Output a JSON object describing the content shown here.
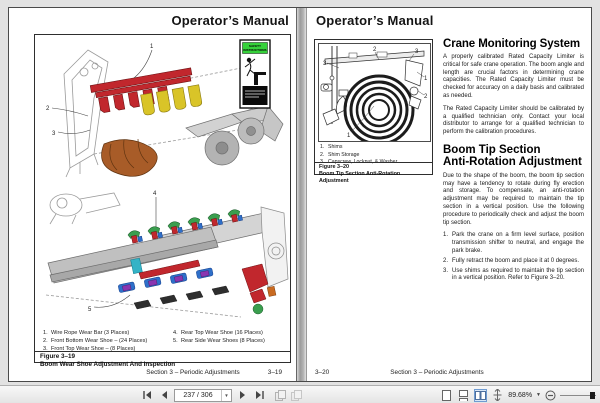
{
  "colors": {
    "safety_green": "#35d13a",
    "diagram_red": "#c1272d",
    "diagram_yellow": "#d9c428",
    "diagram_orange": "#a85c28",
    "diagram_green": "#3a9e4e",
    "diagram_blue": "#2e6fc9",
    "diagram_cyan": "#35b3c6",
    "diagram_purple": "#8a35b0",
    "active_view_blue": "#6f9bd1"
  },
  "left_page": {
    "header": "Operator’s Manual",
    "figure": {
      "callouts": [
        "1",
        "2",
        "3",
        "4",
        "5"
      ],
      "safety_label": {
        "line1": "SAFETY",
        "line2": "INSTRUCTIONS"
      },
      "legend_col1": [
        {
          "num": "1.",
          "text": "Wire Rope Wear Bar (3 Places)"
        },
        {
          "num": "2.",
          "text": "Front Bottom Wear Shoe – (24 Places)"
        },
        {
          "num": "3.",
          "text": "Front Top Wear Shoe – (8 Places)"
        }
      ],
      "legend_col2": [
        {
          "num": "4.",
          "text": "Rear Top Wear Shoe (16 Places)"
        },
        {
          "num": "5.",
          "text": "Rear Side Wear Shoes (8 Places)"
        }
      ],
      "caption_number": "Figure 3–19",
      "caption_title": "Boom Wear Shoe Adjustment And Inspection"
    },
    "footer_section": "Section 3 – Periodic Adjustments",
    "footer_page": "3–19"
  },
  "right_page": {
    "header": "Operator’s Manual",
    "figure": {
      "callouts": [
        "3",
        "2",
        "3",
        "1",
        "2",
        "1"
      ],
      "legend": [
        {
          "num": "1.",
          "text": "Shims"
        },
        {
          "num": "2.",
          "text": "Shim Storage"
        },
        {
          "num": "3.",
          "text": "Capscrew, Locknut, & Washer"
        }
      ],
      "caption_number": "Figure 3–20",
      "caption_title": "Boom Tip Section Anti-Rotation Adjustment"
    },
    "section_crane": {
      "heading": "Crane Monitoring System",
      "para1": "A properly calibrated Rated Capacity Limiter is critical for safe crane operation.  The boom angle and length are crucial factors in determining crane capacities.  The Rated Capacity Limiter must be checked for accuracy on a daily basis and calibrated as needed.",
      "para2": "The Rated Capacity Limiter should be calibrated by a qualified technician only.  Contact your local distributor to arrange for a qualified technician to perform the calibration procedures."
    },
    "section_boom_tip": {
      "heading_line1": "Boom Tip Section",
      "heading_line2": "Anti-Rotation Adjustment",
      "para1": "Due to the shape of the boom, the boom tip section may have a tendency to rotate during fly erection and storage.  To compensate, an anti-rotation adjustment may be required to maintain the tip section in a vertical position.  Use the following procedure to periodically check and adjust the boom tip section.",
      "steps": [
        {
          "num": "1.",
          "text": "Park the crane on a firm level surface, position transmission shifter to neutral, and engage the park brake."
        },
        {
          "num": "2.",
          "text": "Fully retract the boom and place it at 0 degrees."
        },
        {
          "num": "3.",
          "text": "Use shims as required to maintain the tip section in a vertical position.  Refer to Figure 3–20."
        }
      ]
    },
    "footer_page": "3–20",
    "footer_section": "Section 3 – Periodic Adjustments"
  },
  "toolbar": {
    "page_field": "237 / 306",
    "zoom_level": "89.68%"
  }
}
